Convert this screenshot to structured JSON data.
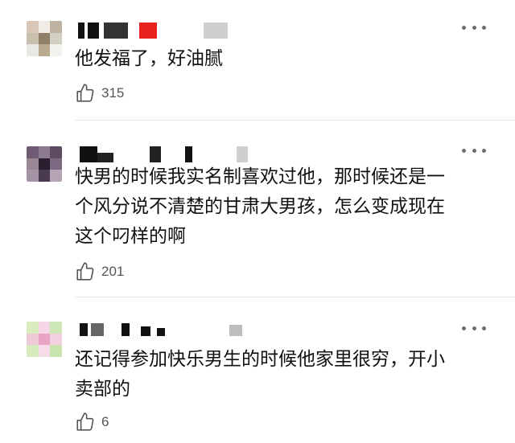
{
  "comments": [
    {
      "text": "他发福了，好油腻",
      "likes": "315",
      "avatar_colors": [
        "#d9c7b8",
        "#f1ece6",
        "#bfb2a3",
        "#c8c0ad",
        "#8f8067",
        "#d2d0c2",
        "#e8e8e4",
        "#b7aa8f",
        "#f4f2ee"
      ],
      "username_blocks_colors": [
        "#111111",
        "#111111",
        "#e8211f",
        "#bdbdbd"
      ]
    },
    {
      "text": "快男的时候我实名制喜欢过他，那时候还是一\n个风分说不清楚的甘肃大男孩，怎么变成现在\n这个叼样的啊",
      "likes": "201",
      "avatar_colors": [
        "#6f5a73",
        "#8c7a8e",
        "#5c4b61",
        "#9a8796",
        "#2a1f2e",
        "#7d6a82",
        "#a493a6",
        "#4a3a50",
        "#b5a4b3"
      ],
      "username_blocks_colors": [
        "#111111",
        "#111111",
        "#bdbdbd"
      ]
    },
    {
      "text": "还记得参加快乐男生的时候他家里很穷，开小\n卖部的",
      "likes": "6",
      "avatar_colors": [
        "#d8ecc0",
        "#f4d6e6",
        "#cde6b5",
        "#f0c9d9",
        "#e9a3c4",
        "#f3d0df",
        "#d5ebbd",
        "#f6dbe8",
        "#c9e3ae"
      ],
      "username_blocks_colors": [
        "#111111",
        "#111111",
        "#bdbdbd"
      ]
    }
  ],
  "icons": {
    "like": "thumbs-up-icon",
    "more": "more-dots-icon"
  },
  "colors": {
    "text": "#111111",
    "meta": "#555555",
    "divider": "#e8e8e8"
  }
}
